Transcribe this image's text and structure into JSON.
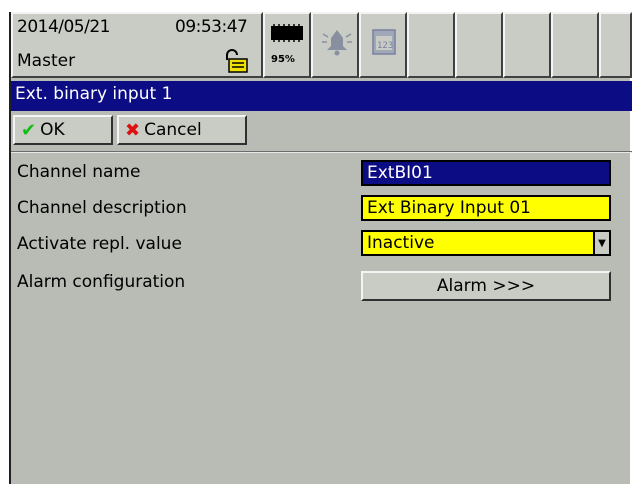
{
  "header": {
    "date": "2014/05/21",
    "time": "09:53:47",
    "user": "Master",
    "memory_pct": "95%",
    "icons": [
      "lock-open-icon",
      "memory-card-icon",
      "alarm-bell-icon",
      "calendar-icon"
    ]
  },
  "title": "Ext. binary input 1",
  "toolbar": {
    "ok_label": "OK",
    "cancel_label": "Cancel"
  },
  "form": {
    "channel_name_label": "Channel name",
    "channel_name_value": "ExtBI01",
    "channel_desc_label": "Channel description",
    "channel_desc_value": "Ext Binary Input 01",
    "repl_label": "Activate repl. value",
    "repl_value": "Inactive",
    "alarm_label": "Alarm configuration",
    "alarm_button": "Alarm >>>"
  },
  "colors": {
    "title_bar": "#0c0c84",
    "highlight_field": "#ffff00",
    "panel": "#b8bcb4"
  }
}
